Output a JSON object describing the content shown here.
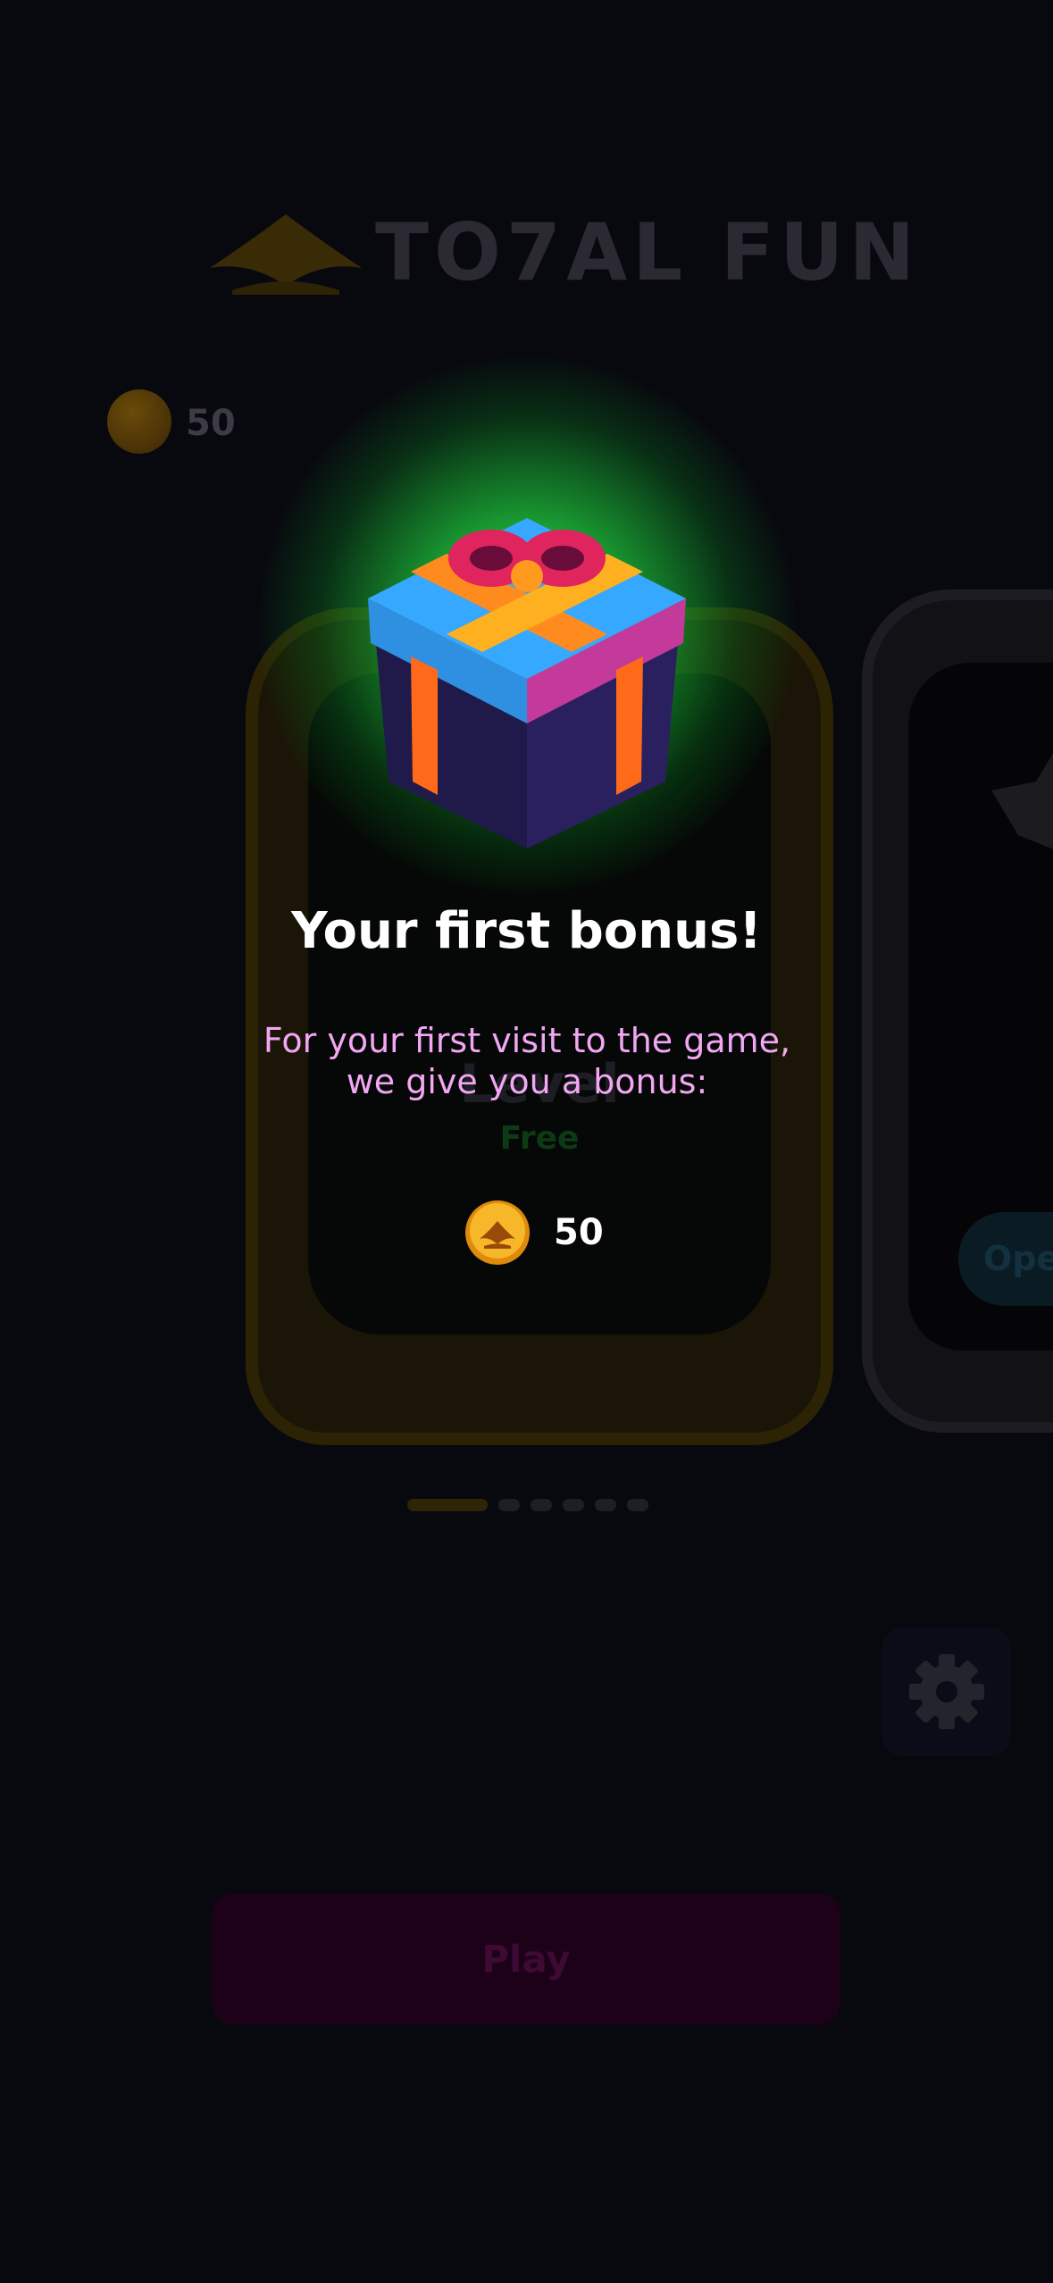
{
  "background": {
    "logo_text": "TO7AL FUN",
    "balance": "50",
    "card": {
      "level_label": "Level",
      "price_label": "Free"
    },
    "next_card": {
      "open_label": "Ope"
    },
    "pagination": {
      "active_index": 0,
      "total": 6
    },
    "play_label": "Play"
  },
  "modal": {
    "title": "Your first bonus!",
    "description_line1": "For your first visit to the game,",
    "description_line2": "we give you a bonus:",
    "reward_amount": "50"
  },
  "icons": {
    "logo": "crown-logo-icon",
    "coin": "coin-icon",
    "gift": "gift-box-icon",
    "settings": "gear-icon",
    "star": "star-icon"
  },
  "colors": {
    "background": "#08080f",
    "modal_glow": "#3dff5a",
    "title": "#ffffff",
    "description": "#f2a6f3",
    "coin": "#f2a41a",
    "play_button": "#1d0119"
  }
}
